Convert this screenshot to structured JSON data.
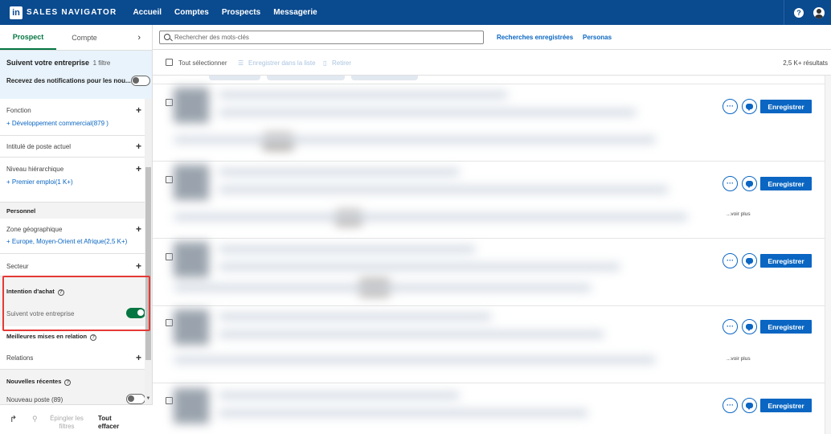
{
  "nav": {
    "logo_text": "in",
    "brand": "SALES NAVIGATOR",
    "links": [
      "Accueil",
      "Comptes",
      "Prospects",
      "Messagerie"
    ],
    "help_glyph": "?"
  },
  "sidebar": {
    "tabs": [
      "Prospect",
      "Compte"
    ],
    "chevron": "›",
    "summary": {
      "title": "Suivent votre entreprise",
      "count": "1 filtre",
      "notification_label": "Recevez des notifications pour les nou...",
      "notification_on": false
    },
    "filters": {
      "fonction": {
        "label": "Fonction",
        "chip": "Développement commercial(879 )"
      },
      "intitule": {
        "label": "Intitulé de poste actuel"
      },
      "niveau": {
        "label": "Niveau hiérarchique",
        "chip": "Premier emploi(1 K+)"
      },
      "personnel_section": "Personnel",
      "zone": {
        "label": "Zone géographique",
        "chip": "Europe, Moyen-Orient et Afrique(2,5 K+)"
      },
      "secteur": {
        "label": "Secteur"
      },
      "intention_section": "Intention d'achat",
      "suivent": {
        "label": "Suivent votre entreprise",
        "on": true
      },
      "meilleures_section": "Meilleures mises en relation",
      "relations": {
        "label": "Relations"
      },
      "nouvelles_section": "Nouvelles récentes",
      "nouveau_poste": {
        "label": "Nouveau poste (89)"
      }
    },
    "footer": {
      "share_glyph": "↱",
      "pin_label": "Épingler les filtres",
      "clear_label": "Tout effacer"
    }
  },
  "topbar": {
    "search_placeholder": "Rechercher des mots-clés",
    "saved_searches": "Recherches enregistrées",
    "personas": "Personas"
  },
  "results_header": {
    "select_all": "Tout sélectionner",
    "save_to_list": "Enregistrer dans la liste",
    "remove": "Retirer",
    "count": "2,5 K+ résultats"
  },
  "results": [
    {
      "more_glyph": "···",
      "save_label": "Enregistrer",
      "see_more": ""
    },
    {
      "more_glyph": "···",
      "save_label": "Enregistrer",
      "see_more": "...voir plus"
    },
    {
      "more_glyph": "···",
      "save_label": "Enregistrer",
      "see_more": ""
    },
    {
      "more_glyph": "···",
      "save_label": "Enregistrer",
      "see_more": "...voir plus"
    },
    {
      "more_glyph": "···",
      "save_label": "Enregistrer",
      "see_more": ""
    }
  ],
  "colors": {
    "nav_bg": "#0a4a8f",
    "accent_green": "#057642",
    "link_blue": "#0a66c2",
    "highlight_red": "#e53935"
  }
}
